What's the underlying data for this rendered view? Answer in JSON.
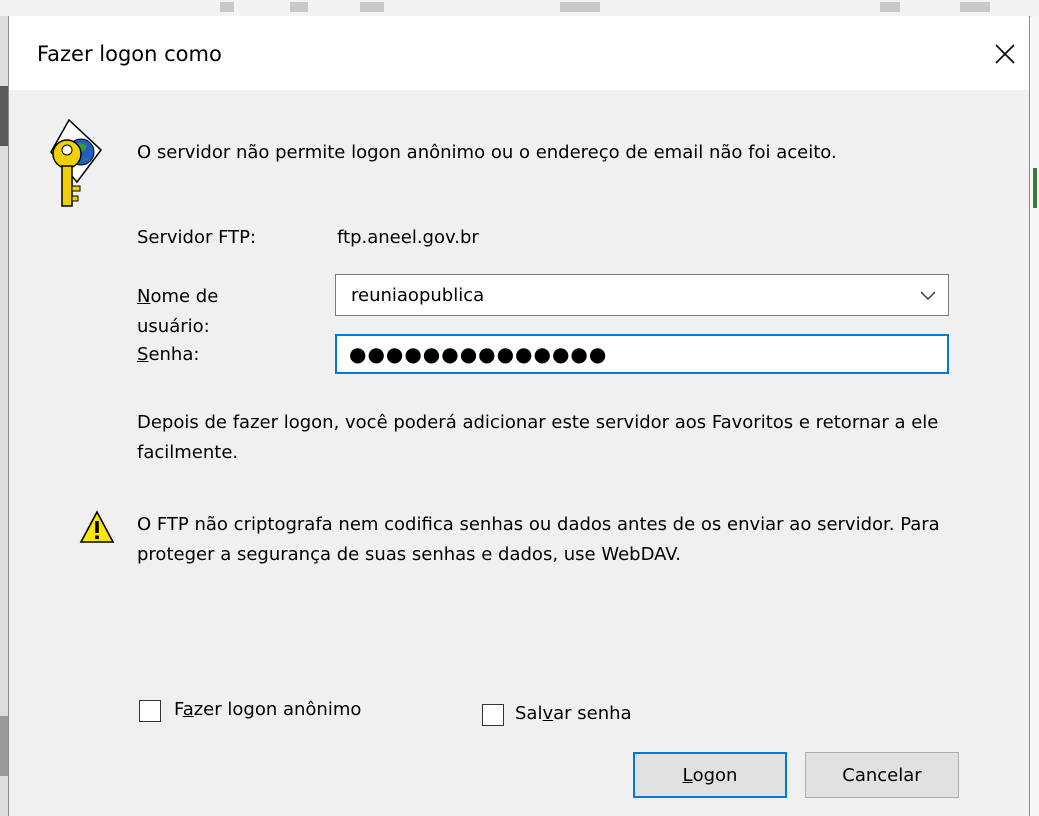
{
  "window": {
    "title": "Fazer logon como"
  },
  "message": "O servidor não permite logon anônimo ou o endereço de email não foi aceito.",
  "server": {
    "label": "Servidor FTP:",
    "value": "ftp.aneel.gov.br"
  },
  "username": {
    "label_line1_access": "N",
    "label_line1_rest": "ome de",
    "label_line2": "usuário:",
    "value": "reuniaopublica"
  },
  "password": {
    "label_access": "S",
    "label_rest": "enha:",
    "masked_value": "●●●●●●●●●●●●●●"
  },
  "info": "Depois de fazer logon, você poderá adicionar este servidor aos Favoritos e retornar a ele facilmente.",
  "warning": "O FTP não criptografa nem codifica senhas ou dados antes de os enviar ao servidor. Para proteger a segurança de suas senhas e dados, use WebDAV.",
  "anonymous_checkbox": {
    "pre": "F",
    "access": "a",
    "post": "zer logon anônimo",
    "checked": false
  },
  "save_password_checkbox": {
    "pre": "Sal",
    "access": "v",
    "post": "ar senha",
    "checked": false
  },
  "buttons": {
    "logon_access": "L",
    "logon_rest": "ogon",
    "cancel": "Cancelar"
  },
  "icons": {
    "dialog_icon": "key-globe-icon",
    "warning_icon": "warning-icon",
    "close": "close-icon",
    "dropdown": "chevron-down-icon"
  },
  "colors": {
    "focus": "#0078d7",
    "dialog_bg": "#f0f0f0",
    "warning_yellow": "#ffe600"
  }
}
